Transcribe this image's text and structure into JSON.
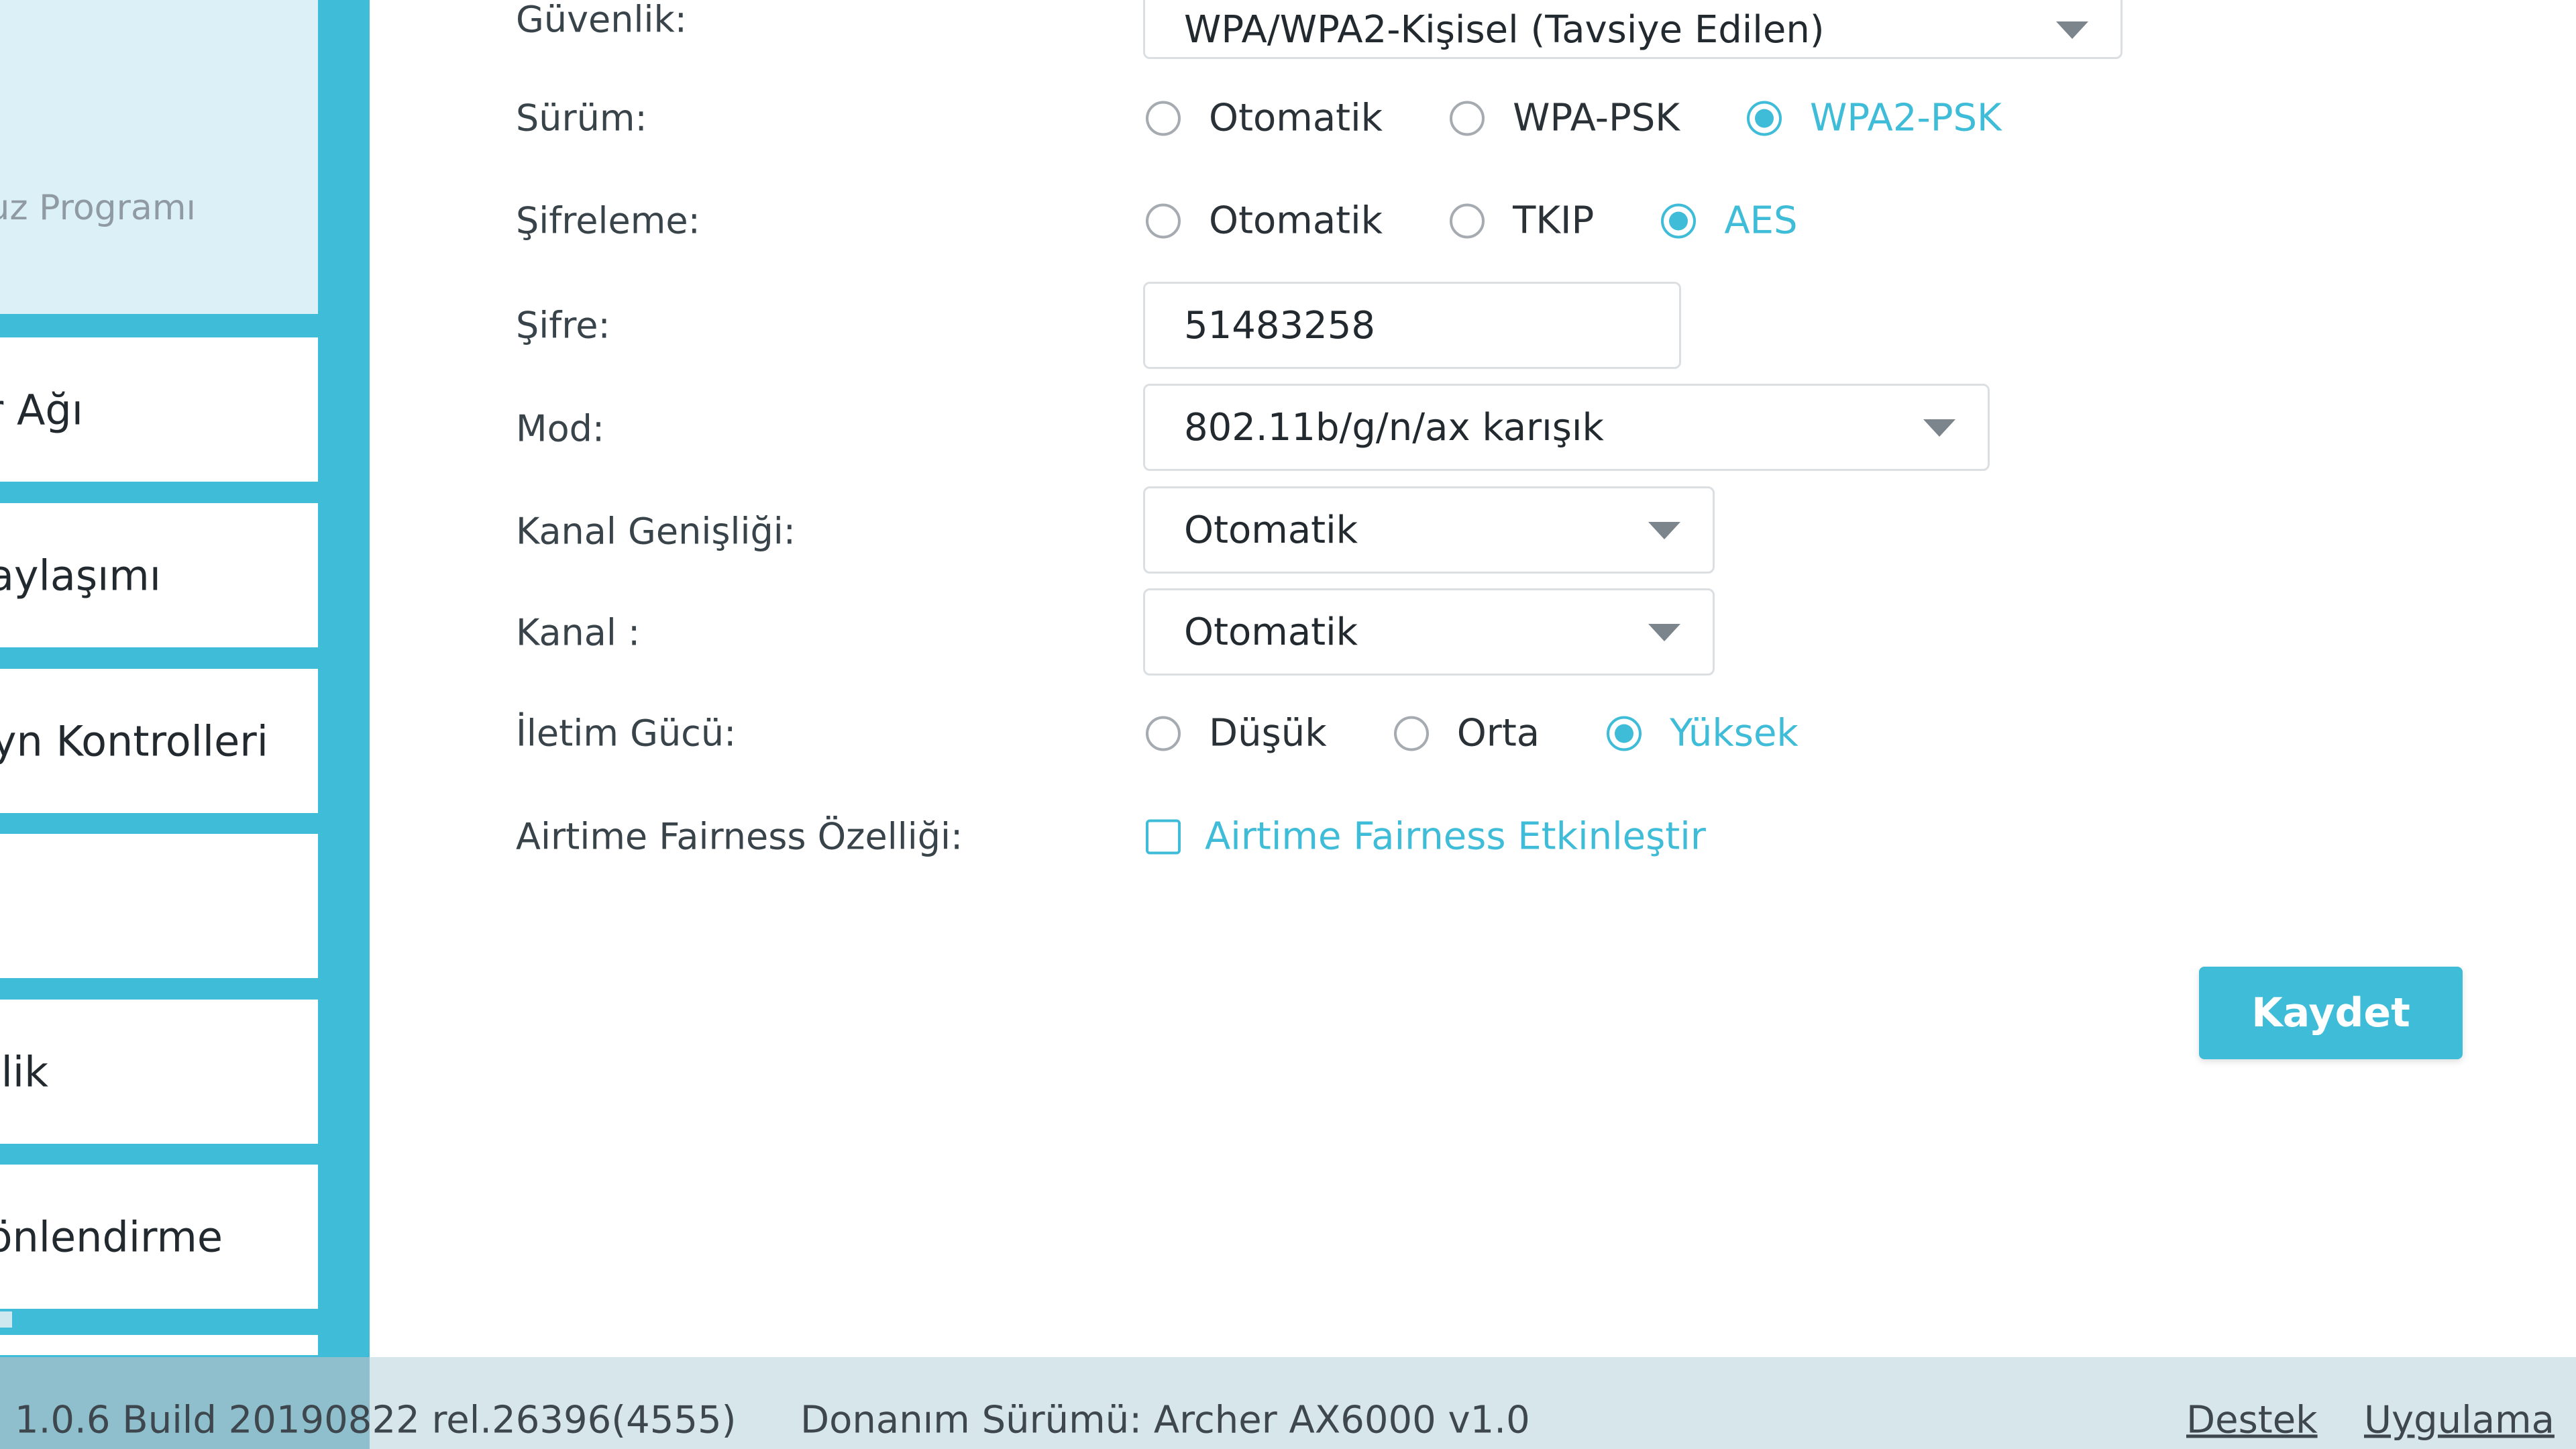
{
  "colors": {
    "accent": "#3fbcd7",
    "sidebar_background": "#3fbcd7",
    "footer_background": "#d7e6ea"
  },
  "sidebar": {
    "top_label": "uz Programı",
    "items": [
      {
        "label": "r Ağı"
      },
      {
        "label": "aylaşımı"
      },
      {
        "label": "yn Kontrolleri"
      },
      {
        "label": ""
      },
      {
        "label": "lik"
      },
      {
        "label": "önlendirme"
      }
    ]
  },
  "form": {
    "security": {
      "label": "Güvenlik:",
      "value": "WPA/WPA2-Kişisel (Tavsiye Edilen)",
      "icon": "chevron-down-icon"
    },
    "version": {
      "label": "Sürüm:",
      "options": [
        "Otomatik",
        "WPA-PSK",
        "WPA2-PSK"
      ],
      "selected": "WPA2-PSK"
    },
    "encryption": {
      "label": "Şifreleme:",
      "options": [
        "Otomatik",
        "TKIP",
        "AES"
      ],
      "selected": "AES"
    },
    "password": {
      "label": "Şifre:",
      "value": "51483258"
    },
    "mode": {
      "label": "Mod:",
      "value": "802.11b/g/n/ax karışık",
      "icon": "chevron-down-icon"
    },
    "channel_width": {
      "label": "Kanal Genişliği:",
      "value": "Otomatik",
      "icon": "chevron-down-icon"
    },
    "channel": {
      "label": "Kanal :",
      "value": "Otomatik",
      "icon": "chevron-down-icon"
    },
    "transmit_power": {
      "label": "İletim Gücü:",
      "options": [
        "Düşük",
        "Orta",
        "Yüksek"
      ],
      "selected": "Yüksek"
    },
    "airtime_fairness": {
      "label": "Airtime Fairness Özelliği:",
      "checkbox_label": "Airtime Fairness Etkinleştir",
      "checked": false
    },
    "save_label": "Kaydet"
  },
  "footer": {
    "firmware": "1.0.6 Build 20190822 rel.26396(4555)",
    "hardware": "Donanım Sürümü: Archer AX6000 v1.0",
    "links": [
      "Destek",
      "Uygulama"
    ]
  }
}
